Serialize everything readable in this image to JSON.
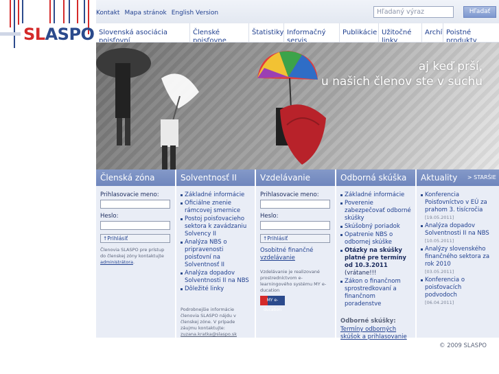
{
  "logo": {
    "text_a": "SL",
    "text_b": "AS",
    "text_c": "PO"
  },
  "header": {
    "links": [
      "Kontakt",
      "Mapa stránok",
      "English Version"
    ],
    "search_placeholder": "Hľadaný výraz",
    "search_button": "Hľadať"
  },
  "nav": {
    "items": [
      "Slovenská asociácia poisťovní",
      "Členské poisťovne",
      "Štatistiky",
      "Informačný servis",
      "Publikácie",
      "Užitočné linky",
      "Archív",
      "Poistné produkty"
    ]
  },
  "hero": {
    "line1": "aj keď prší,",
    "line2": "u našich členov ste v suchu"
  },
  "columns": {
    "members": {
      "title": "Členská zóna",
      "username_label": "Prihlasovacie meno:",
      "password_label": "Heslo:",
      "login_button": "Prihlásiť",
      "note_1": "Členovia SLASPO pre prístup do členskej zóny kontaktujte",
      "note_link": "administrátora",
      "note_end": "."
    },
    "solvency": {
      "title": "Solventnosť II",
      "items": [
        "Základné informácie",
        "Oficiálne znenie rámcovej smernice",
        "Postoj poisťovacieho sektora k zavádzaniu Solvency II",
        "Analýza NBS o pripravenosti poisťovní na Solventnosť II",
        "Analýza dopadov Solventnosti II na NBS",
        "Dôležité linky"
      ],
      "note": "Podrobnejšie informácie členovia SLASPO nájdu v členskej zóne. V prípade záujmu kontaktujte:",
      "email": "zuzana.kratka@slaspo.sk"
    },
    "education": {
      "title": "Vzdelávanie",
      "username_label": "Prihlasovacie meno:",
      "password_label": "Heslo:",
      "login_button": "Prihlásiť",
      "link_1": "Osobitné finančné",
      "link_2": "vzdelávanie",
      "note": "Vzdelávanie je realizované prostredníctvom e-learningového systému MY e-ducation",
      "mini_logo": "MY e-ducation"
    },
    "exam": {
      "title": "Odborná skúška",
      "items": [
        "Základné informácie",
        "Poverenie zabezpečovať odborné skúšky",
        "Skúšobný poriadok",
        "Opatrenie NBS o odbornej skúške",
        "Otázky na skúšky platné pre termíny od 10.3.2011",
        "Zákon o finančnom sprostredkovaní a finančnom poradenstve"
      ],
      "bold_suffix": "(vrátane!!!",
      "subhead": "Odborné skúšky:",
      "link": "Termíny odborných skúšok a prihlasovanie"
    },
    "news": {
      "title": "Aktuality",
      "older": "> STARŠIE",
      "items": [
        {
          "text": "Konferencia Poisťovníctvo v EÚ za prahom 3. tisícročia",
          "date": "[19.05.2011]"
        },
        {
          "text": "Analýza dopadov Solventnosti II na NBS",
          "date": "[10.05.2011]"
        },
        {
          "text": "Analýzy slovenského finančného sektora za rok 2010",
          "date": "[03.05.2011]"
        },
        {
          "text": "Konferencia o poisťovacích podvodoch",
          "date": "[06.04.2011]"
        }
      ]
    }
  },
  "footer": {
    "copyright": "© 2009 SLASPO"
  },
  "colors": {
    "accent_red": "#d42a2a",
    "accent_blue": "#2b4a8c",
    "column_header": "#7a90c3"
  }
}
